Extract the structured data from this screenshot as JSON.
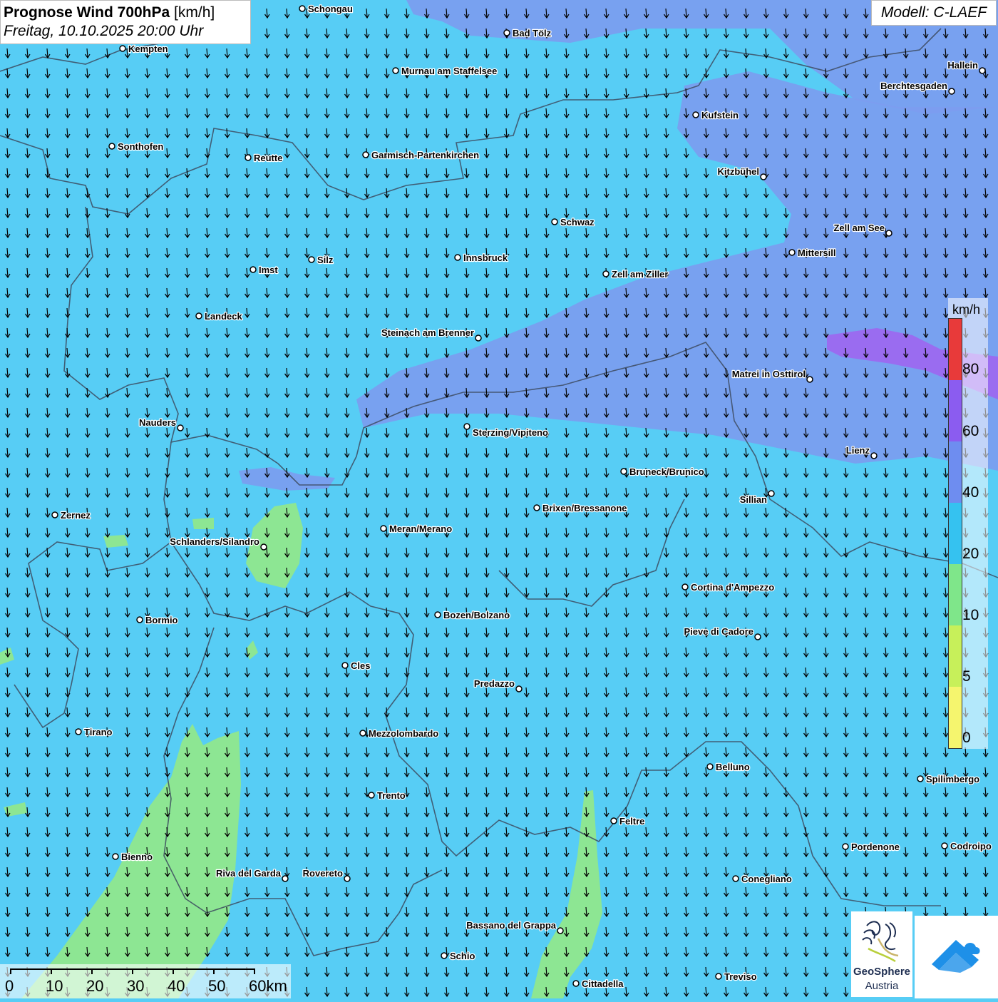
{
  "title": {
    "bold": "Prognose Wind 700hPa",
    "unit": "[km/h]",
    "subtitle": "Freitag, 10.10.2025 20:00 Uhr"
  },
  "model_label": "Modell: C-LAEF",
  "legend": {
    "unit": "km/h",
    "labels": [
      "80",
      "60",
      "40",
      "20",
      "10",
      "5",
      "0"
    ],
    "colors": [
      "#e83a3a",
      "#8b5cf0",
      "#6e8df0",
      "#35c2f0",
      "#7fe68a",
      "#c7f05a",
      "#f5f56e"
    ]
  },
  "colors": {
    "background_20_40": "#57cdf5",
    "band_40_60": "#7c9cf0",
    "band_60_80": "#9a6cf0",
    "band_10_20": "#8de693",
    "borders": "#3d4b60"
  },
  "scale_bar": {
    "labels": [
      "0",
      "10",
      "20",
      "30",
      "40",
      "50",
      "60km"
    ]
  },
  "wind_direction": "from north (arrows pointing south)",
  "cities": [
    {
      "name": "Schongau"
    },
    {
      "name": "Kempten"
    },
    {
      "name": "Bad Tölz"
    },
    {
      "name": "Murnau am Staffelsee"
    },
    {
      "name": "Hallein"
    },
    {
      "name": "Berchtesgaden"
    },
    {
      "name": "Kufstein"
    },
    {
      "name": "Sonthofen"
    },
    {
      "name": "Reutte"
    },
    {
      "name": "Garmisch-Partenkirchen"
    },
    {
      "name": "Kitzbühel"
    },
    {
      "name": "Schwaz"
    },
    {
      "name": "Zell am See"
    },
    {
      "name": "Mittersill"
    },
    {
      "name": "Innsbruck"
    },
    {
      "name": "Silz"
    },
    {
      "name": "Imst"
    },
    {
      "name": "Zell am Ziller"
    },
    {
      "name": "Landeck"
    },
    {
      "name": "Steinach am Brenner"
    },
    {
      "name": "Matrei in Osttirol"
    },
    {
      "name": "Nauders"
    },
    {
      "name": "Sterzing/Vipiteno"
    },
    {
      "name": "Lienz"
    },
    {
      "name": "Bruneck/Brunico"
    },
    {
      "name": "Sillian"
    },
    {
      "name": "Zernez"
    },
    {
      "name": "Brixen/Bressanone"
    },
    {
      "name": "Meran/Merano"
    },
    {
      "name": "Schlanders/Silandro"
    },
    {
      "name": "Cortina d'Ampezzo"
    },
    {
      "name": "Bozen/Bolzano"
    },
    {
      "name": "Bormio"
    },
    {
      "name": "Pieve di Cadore"
    },
    {
      "name": "Cles"
    },
    {
      "name": "Predazzo"
    },
    {
      "name": "Tirano"
    },
    {
      "name": "Mezzolombardo"
    },
    {
      "name": "Belluno"
    },
    {
      "name": "Spilimbergo"
    },
    {
      "name": "Trento"
    },
    {
      "name": "Feltre"
    },
    {
      "name": "Pordenone"
    },
    {
      "name": "Codroipo"
    },
    {
      "name": "Bienno"
    },
    {
      "name": "Riva del Garda"
    },
    {
      "name": "Rovereto"
    },
    {
      "name": "Conegliano"
    },
    {
      "name": "Bassano del Grappa"
    },
    {
      "name": "Schio"
    },
    {
      "name": "Treviso"
    },
    {
      "name": "Cittadella"
    }
  ],
  "logo": {
    "name_line1": "GeoSphere",
    "name_line2": "Austria"
  }
}
